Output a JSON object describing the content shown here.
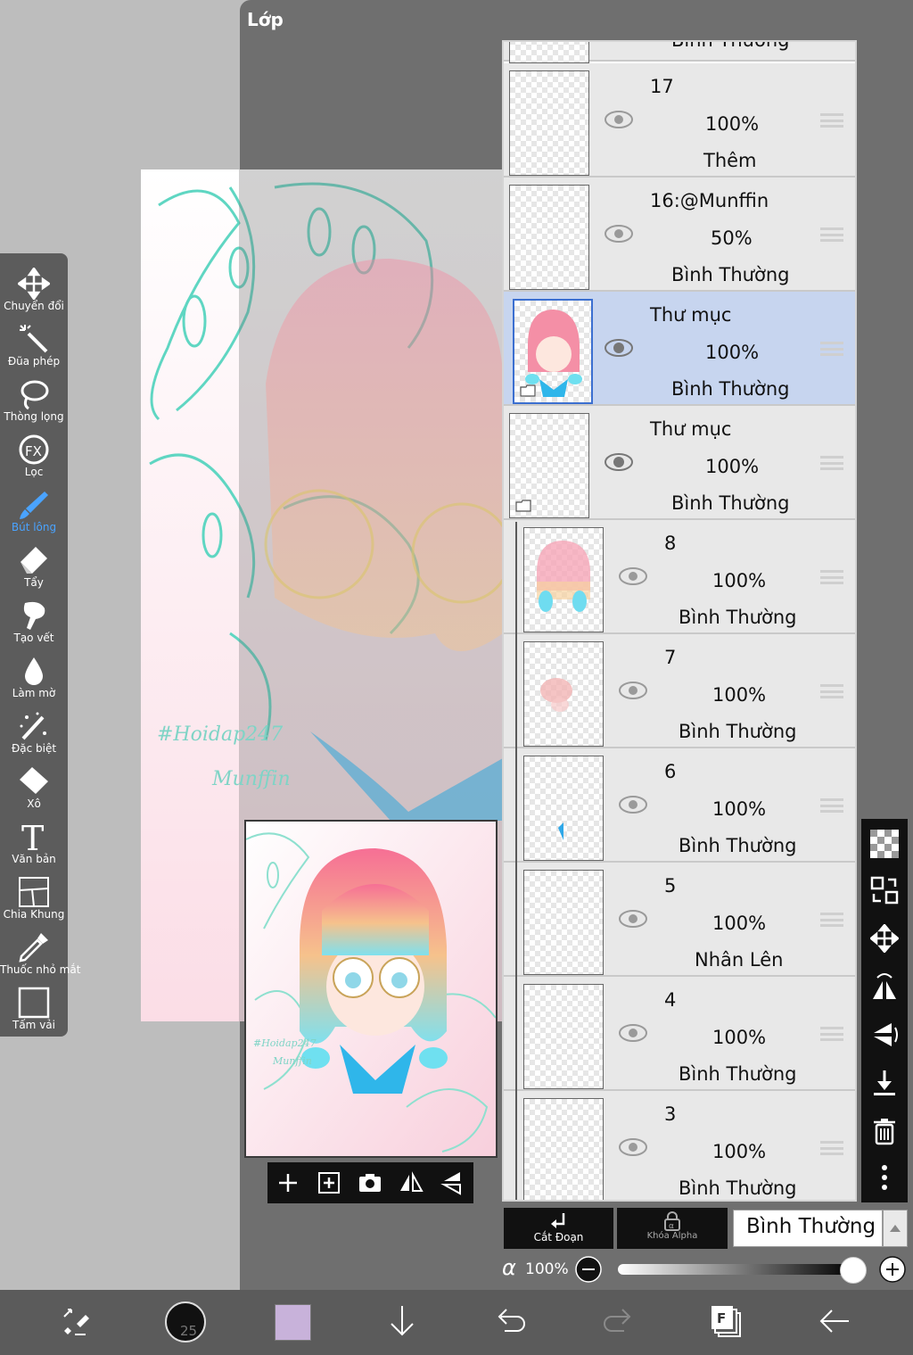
{
  "panel": {
    "title": "Lớp"
  },
  "toolbar": {
    "tools": [
      {
        "label": "Chuyển đổi",
        "icon": "move-arrows-icon"
      },
      {
        "label": "Đũa phép",
        "icon": "magic-wand-icon"
      },
      {
        "label": "Thòng lọng",
        "icon": "lasso-icon"
      },
      {
        "label": "Lọc",
        "icon": "fx-filter-icon"
      },
      {
        "label": "Bút lông",
        "icon": "brush-icon",
        "active": true
      },
      {
        "label": "Tẩy",
        "icon": "eraser-icon"
      },
      {
        "label": "Tạo vết",
        "icon": "smudge-icon"
      },
      {
        "label": "Làm mờ",
        "icon": "blur-drop-icon"
      },
      {
        "label": "Đặc biệt",
        "icon": "special-brush-icon"
      },
      {
        "label": "Xô",
        "icon": "bucket-icon"
      },
      {
        "label": "Văn bản",
        "icon": "text-icon"
      },
      {
        "label": "Chia Khung",
        "icon": "frame-divider-icon"
      },
      {
        "label": "Thuốc nhỏ mắt",
        "icon": "eyedropper-icon"
      },
      {
        "label": "Tấm vải",
        "icon": "canvas-icon"
      }
    ],
    "active_color": "#4aa3ff"
  },
  "artwork": {
    "watermark_line1": "#Hoidap247",
    "watermark_line2": "Munffin"
  },
  "layers": {
    "partial_top_mode": "Bình Thường",
    "items": [
      {
        "name": "17",
        "opacity": "100%",
        "mode": "Thêm"
      },
      {
        "name": "16:@Munffin",
        "opacity": "50%",
        "mode": "Bình Thường"
      },
      {
        "name": "Thư mục",
        "opacity": "100%",
        "mode": "Bình Thường",
        "selected": true,
        "folder": true
      },
      {
        "name": "Thư mục",
        "opacity": "100%",
        "mode": "Bình Thường",
        "folder": true
      },
      {
        "name": "8",
        "opacity": "100%",
        "mode": "Bình Thường",
        "indent": true
      },
      {
        "name": "7",
        "opacity": "100%",
        "mode": "Bình Thường",
        "indent": true
      },
      {
        "name": "6",
        "opacity": "100%",
        "mode": "Bình Thường",
        "indent": true
      },
      {
        "name": "5",
        "opacity": "100%",
        "mode": "Nhân Lên",
        "indent": true
      },
      {
        "name": "4",
        "opacity": "100%",
        "mode": "Bình Thường",
        "indent": true
      },
      {
        "name": "3",
        "opacity": "100%",
        "mode": "Bình Thường",
        "indent": true
      }
    ],
    "selected_color": "#c7d5ef"
  },
  "layer_controls": {
    "clip_label": "Cắt Đoạn",
    "alpha_lock_label": "Khóa Alpha",
    "blend_mode": "Bình Thường",
    "alpha_symbol": "α",
    "alpha_value": "100%",
    "alpha_level": 1.0
  },
  "bottom": {
    "brush_size": "25",
    "current_color": "#c8b2da"
  }
}
